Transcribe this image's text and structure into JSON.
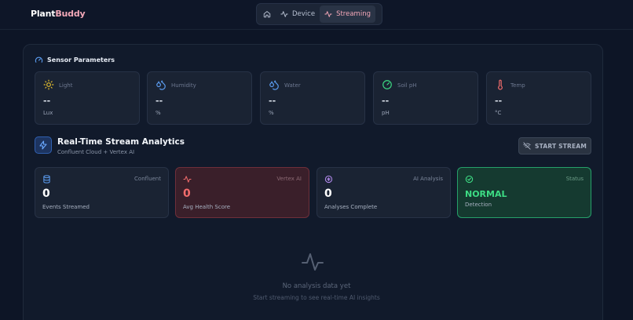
{
  "brand": {
    "part1": "Plant",
    "part2": "Buddy"
  },
  "nav": {
    "device_label": "Device",
    "streaming_label": "Streaming"
  },
  "sensors": {
    "title": "Sensor Parameters",
    "items": [
      {
        "label": "Light",
        "value": "--",
        "unit": "Lux",
        "icon": "sun-icon"
      },
      {
        "label": "Humidity",
        "value": "--",
        "unit": "%",
        "icon": "droplets-icon"
      },
      {
        "label": "Water",
        "value": "--",
        "unit": "%",
        "icon": "droplets-icon"
      },
      {
        "label": "Soil pH",
        "value": "--",
        "unit": "pH",
        "icon": "gauge-icon"
      },
      {
        "label": "Temp",
        "value": "--",
        "unit": "°C",
        "icon": "thermometer-icon"
      }
    ]
  },
  "stream": {
    "title": "Real-Time Stream Analytics",
    "subtitle": "Confluent Cloud + Vertex AI",
    "start_label": "START STREAM"
  },
  "cards": [
    {
      "tag": "Confluent",
      "value": "0",
      "label": "Events Streamed",
      "icon": "database-icon"
    },
    {
      "tag": "Vertex AI",
      "value": "0",
      "label": "Avg Health Score",
      "icon": "activity-icon"
    },
    {
      "tag": "AI Analysis",
      "value": "0",
      "label": "Analyses Complete",
      "icon": "brain-icon"
    },
    {
      "tag": "Status",
      "value": "NORMAL",
      "label": "Detection",
      "icon": "check-circle-icon"
    }
  ],
  "empty": {
    "title": "No analysis data yet",
    "subtitle": "Start streaming to see real-time AI insights"
  },
  "colors": {
    "background": "#0d1526",
    "accent_pink": "#f4a7b8",
    "alert_red": "#f36c6c",
    "ok_green": "#3ddc84",
    "info_blue": "#5b9cf0"
  }
}
